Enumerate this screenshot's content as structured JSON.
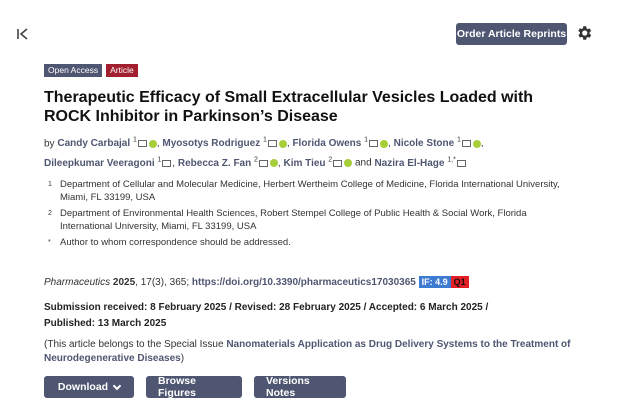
{
  "toolbar": {
    "reprints_label": "Order Article Reprints"
  },
  "badges": {
    "open_access": "Open Access",
    "article": "Article"
  },
  "title": "Therapeutic Efficacy of Small Extracellular Vesicles Loaded with ROCK Inhibitor in Parkinson’s Disease",
  "authors_prefix": "by",
  "authors": [
    {
      "name": "Candy Carbajal",
      "sup": "1"
    },
    {
      "name": "Myosotys Rodriguez",
      "sup": "1"
    },
    {
      "name": "Florida Owens",
      "sup": "1"
    },
    {
      "name": "Nicole Stone",
      "sup": "1"
    },
    {
      "name": "Dileepkumar Veeragoni",
      "sup": "1"
    },
    {
      "name": "Rebecca Z. Fan",
      "sup": "2"
    },
    {
      "name": "Kim Tieu",
      "sup": "2"
    },
    {
      "name": "Nazira El-Hage",
      "sup": "1,*"
    }
  ],
  "authors_and": "and",
  "affiliations": [
    {
      "num": "1",
      "text": "Department of Cellular and Molecular Medicine, Herbert Wertheim College of Medicine, Florida International University, Miami, FL 33199, USA"
    },
    {
      "num": "2",
      "text": "Department of Environmental Health Sciences, Robert Stempel College of Public Health & Social Work, Florida International University, Miami, FL 33199, USA"
    },
    {
      "num": "*",
      "text": "Author to whom correspondence should be addressed."
    }
  ],
  "citation": {
    "journal": "Pharmaceutics",
    "year": "2025",
    "volume_issue": ", 17(3), 365;",
    "doi": "https://doi.org/10.3390/pharmaceutics17030365",
    "impact_factor": "IF: 4.9",
    "quartile": "Q1"
  },
  "dates": {
    "line1": "Submission received: 8 February 2025 / Revised: 28 February 2025 / Accepted: 6 March 2025 /",
    "line2": "Published: 13 March 2025"
  },
  "special_issue": {
    "prefix": "(This article belongs to the Special Issue ",
    "link": "Nanomaterials Application as Drug Delivery Systems to the Treatment of Neurodegenerative Diseases",
    "suffix": ")"
  },
  "actions": {
    "download": "Download",
    "browse": "Browse Figures",
    "versions": "Versions Notes"
  },
  "colors": {
    "primary": "#4f5671",
    "article_badge": "#a11f2f",
    "orcid": "#a6ce39",
    "if_badge": "#3c7bd0",
    "q_badge": "#e31e24"
  }
}
